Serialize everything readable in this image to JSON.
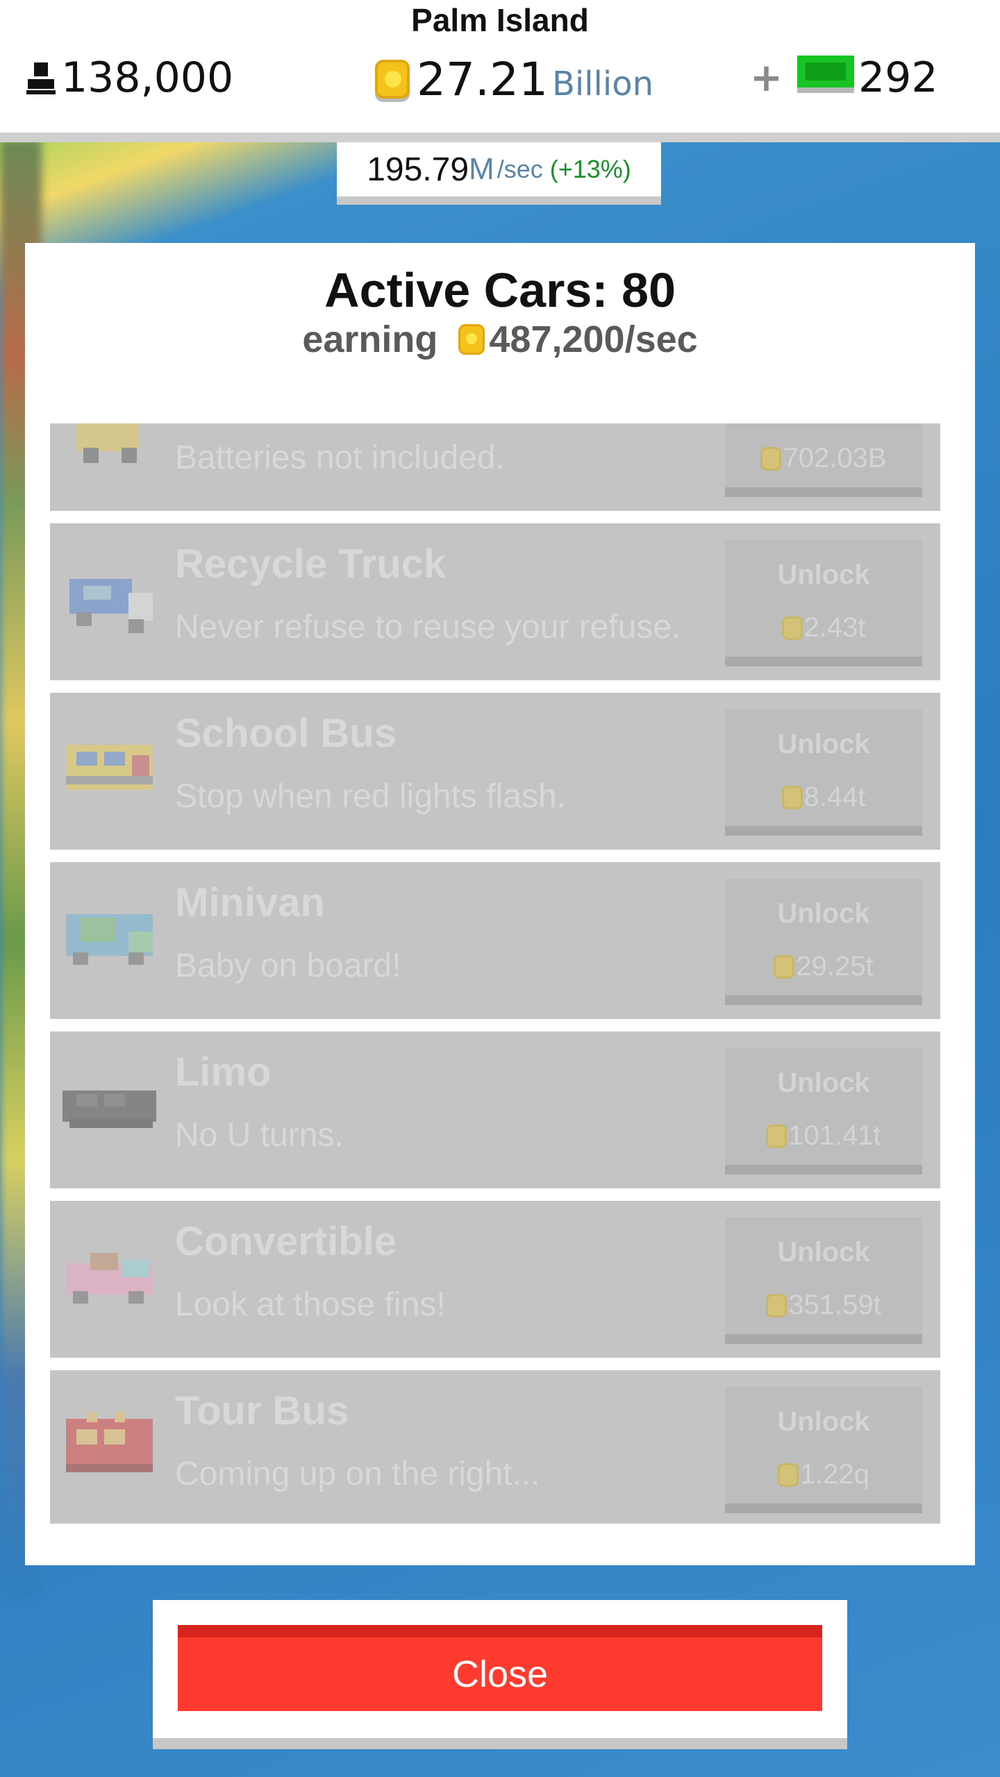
{
  "header": {
    "island_name": "Palm Island",
    "population": "138,000",
    "coins_value": "27.21",
    "coins_unit": "Billion",
    "plus": "+",
    "cash": "292",
    "rate_value": "195.79",
    "rate_unit": "M",
    "rate_suffix": "/sec",
    "rate_bonus": "(+13%)"
  },
  "panel": {
    "title": "Active Cars: 80",
    "earning_label": "earning",
    "earning_value": "487,200/sec"
  },
  "cars": [
    {
      "name": "",
      "description": "Batteries not included.",
      "button_label": "",
      "price": "702.03B",
      "icon": "toy-car-icon"
    },
    {
      "name": "Recycle Truck",
      "description": "Never refuse to reuse your refuse.",
      "button_label": "Unlock",
      "price": "2.43t",
      "icon": "recycle-truck-icon"
    },
    {
      "name": "School Bus",
      "description": "Stop when red lights flash.",
      "button_label": "Unlock",
      "price": "8.44t",
      "icon": "school-bus-icon"
    },
    {
      "name": "Minivan",
      "description": "Baby on board!",
      "button_label": "Unlock",
      "price": "29.25t",
      "icon": "minivan-icon"
    },
    {
      "name": "Limo",
      "description": "No U turns.",
      "button_label": "Unlock",
      "price": "101.41t",
      "icon": "limo-icon"
    },
    {
      "name": "Convertible",
      "description": "Look at those fins!",
      "button_label": "Unlock",
      "price": "351.59t",
      "icon": "convertible-icon"
    },
    {
      "name": "Tour Bus",
      "description": "Coming up on the right...",
      "button_label": "Unlock",
      "price": "1.22q",
      "icon": "tour-bus-icon"
    }
  ],
  "close_label": "Close",
  "colors": {
    "close_button": "#ff3a2e",
    "coin": "#f4c21a",
    "cash": "#18c424",
    "locked_row": "#c4c4c4"
  }
}
